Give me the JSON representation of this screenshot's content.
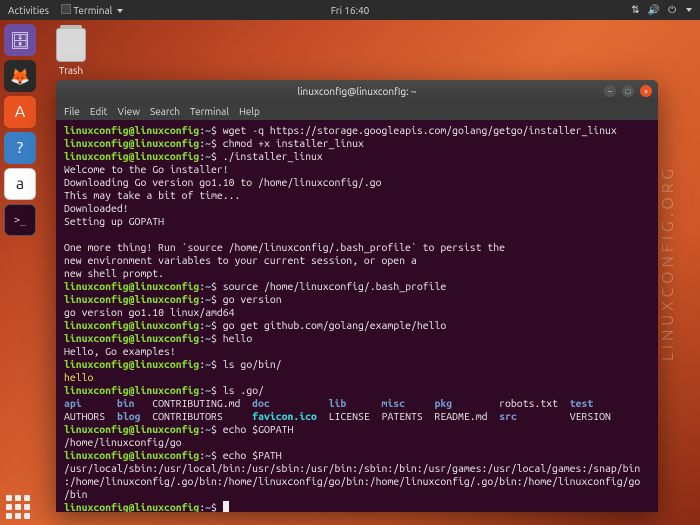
{
  "topbar": {
    "activities": "Activities",
    "app": "Terminal",
    "clock": "Fri 16:40"
  },
  "desktop": {
    "trash_label": "Trash"
  },
  "dock": {
    "files": "🗄",
    "firefox": "🦊",
    "software": "A",
    "help": "?",
    "amazon": "a",
    "terminal_glyph": ">_"
  },
  "window": {
    "title": "linuxconfig@linuxconfig: ~",
    "menus": [
      "File",
      "Edit",
      "View",
      "Search",
      "Terminal",
      "Help"
    ],
    "controls": {
      "min": "–",
      "max": "□",
      "close": "×"
    }
  },
  "prompt": {
    "userhost": "linuxconfig@linuxconfig",
    "colon": ":",
    "path": "~",
    "dollar": "$ "
  },
  "lines": {
    "c1": "wget -q https://storage.googleapis.com/golang/getgo/installer_linux",
    "c2": "chmod +x installer_linux",
    "c3": "./installer_linux",
    "o1": "Welcome to the Go installer!",
    "o2": "Downloading Go version go1.10 to /home/linuxconfig/.go",
    "o3": "This may take a bit of time...",
    "o4": "Downloaded!",
    "o5": "Setting up GOPATH",
    "o6": "One more thing! Run `source /home/linuxconfig/.bash_profile` to persist the",
    "o7": "new environment variables to your current session, or open a",
    "o8": "new shell prompt.",
    "c4": "source /home/linuxconfig/.bash_profile",
    "c5": "go version",
    "o9": "go version go1.10 linux/amd64",
    "c6": "go get github.com/golang/example/hello",
    "c7": "hello",
    "o10": "Hello, Go examples!",
    "c8": "ls go/bin/",
    "o11": "hello",
    "c9": "ls .go/",
    "ls_row1": {
      "api": "api",
      "bin": "bin",
      "contrib_md": "CONTRIBUTING.md",
      "doc": "doc",
      "lib": "lib",
      "misc": "misc",
      "pkg": "pkg",
      "robots": "robots.txt",
      "test": "test"
    },
    "ls_row2": {
      "authors": "AUTHORS",
      "blog": "blog",
      "contributors": "CONTRIBUTORS",
      "favicon": "favicon.ico",
      "license": "LICENSE",
      "patents": "PATENTS",
      "readme": "README.md",
      "src": "src",
      "version": "VERSION"
    },
    "c10": "echo $GOPATH",
    "o12": "/home/linuxconfig/go",
    "c11": "echo $PATH",
    "o13a": "/usr/local/sbin:/usr/local/bin:/usr/sbin:/usr/bin:/sbin:/bin:/usr/games:/usr/local/games:/snap/bin",
    "o13b": ":/home/linuxconfig/.go/bin:/home/linuxconfig/go/bin:/home/linuxconfig/.go/bin:/home/linuxconfig/go",
    "o13c": "/bin"
  },
  "watermark": "LINUXCONFIG.ORG"
}
